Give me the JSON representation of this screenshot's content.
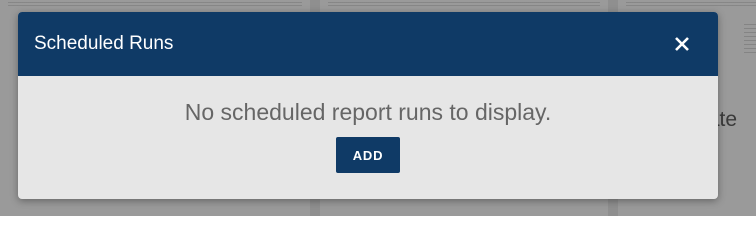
{
  "background": {
    "peek_text": "tate"
  },
  "modal": {
    "title": "Scheduled Runs",
    "close_icon": "close-icon",
    "empty_message": "No scheduled report runs to display.",
    "add_label": "ADD"
  },
  "colors": {
    "header_bg": "#0f3a66",
    "body_bg": "#e6e6e6",
    "button_bg": "#0f3a66",
    "message_text": "#666666"
  }
}
